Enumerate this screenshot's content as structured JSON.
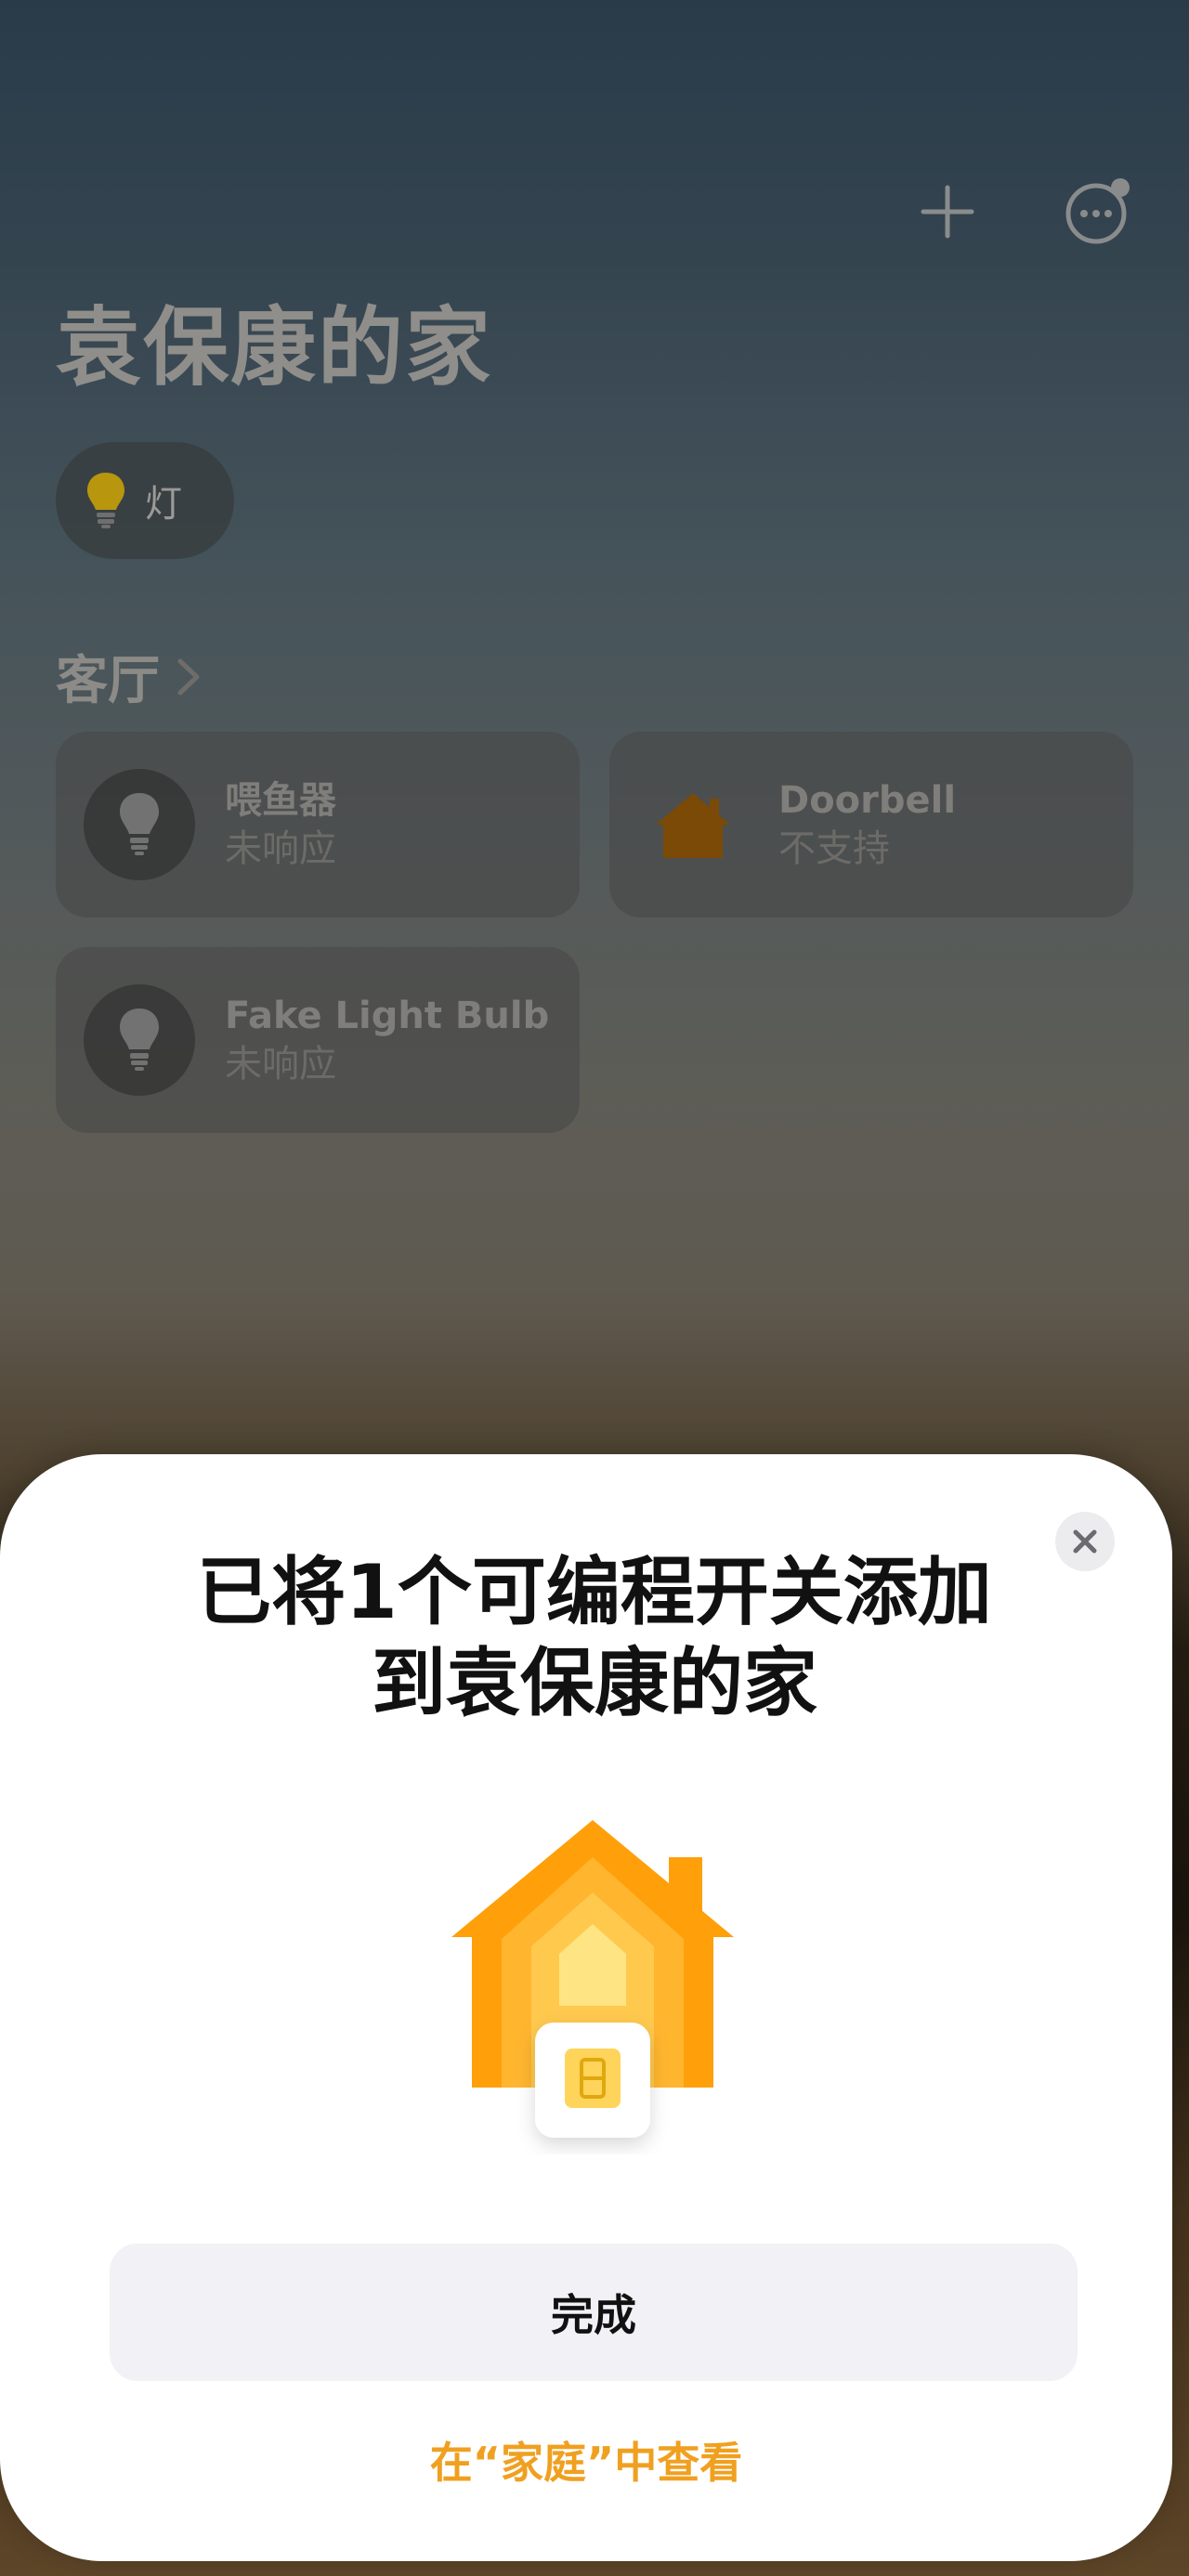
{
  "home": {
    "title": "袁保康的家",
    "category_pill": {
      "label": "灯",
      "icon": "lightbulb-icon"
    },
    "room": {
      "name": "客厅",
      "chevron": "chevron-right-icon"
    },
    "accessories": [
      {
        "name": "喂鱼器",
        "status": "未响应",
        "icon": "lightbulb-icon"
      },
      {
        "name": "Doorbell",
        "status": "不支持",
        "icon": "house-icon"
      },
      {
        "name": "Fake Light Bulb",
        "status": "未响应",
        "icon": "lightbulb-icon"
      }
    ],
    "toolbar": {
      "add_icon": "plus-icon",
      "more_icon": "ellipsis-circle-icon"
    }
  },
  "sheet": {
    "title_line1": "已将1个可编程开关添加",
    "title_line2": "到袁保康的家",
    "close_icon": "close-icon",
    "illustration": "home-with-switch-icon",
    "done_label": "完成",
    "view_link": "在“家庭”中查看"
  },
  "colors": {
    "accent": "#f0a020",
    "house_orange": "#ff9f0a",
    "house_yellow": "#ffd45a",
    "done_bg": "#f1f1f6"
  }
}
